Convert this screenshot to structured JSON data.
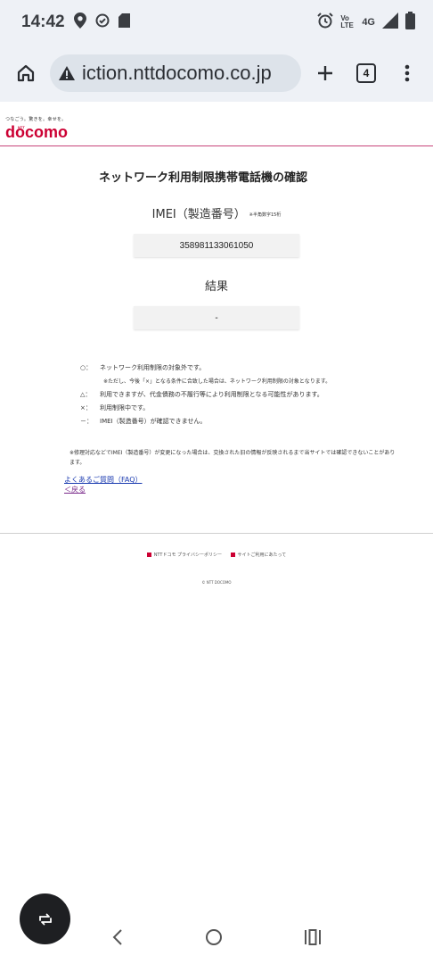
{
  "status_bar": {
    "time": "14:42",
    "network": "4G",
    "volte": "Vo LTE"
  },
  "browser": {
    "url": "iction.nttdocomo.co.jp",
    "tab_count": "4"
  },
  "brand": {
    "tagline": "つなごう。驚きを。幸せを。",
    "ntt": "NTT",
    "logo": "docomo"
  },
  "page": {
    "title": "ネットワーク利用制限携帯電話機の確認",
    "imei_label": "IMEI（製造番号）",
    "imei_note": "※半角数字15桁",
    "imei_value": "358981133061050",
    "result_label": "結果",
    "result_value": "-",
    "legend": [
      {
        "symbol": "○：",
        "text": "ネットワーク利用制限の対象外です。"
      },
      {
        "symbol": "",
        "text": "※ただし、今後「×」となる条件に合致した場合は、ネットワーク利用制限の対象となります。"
      },
      {
        "symbol": "△：",
        "text": "利用できますが、代金債務の不履行等により利用制限となる可能性があります。"
      },
      {
        "symbol": "×：",
        "text": "利用制限中です。"
      },
      {
        "symbol": "－：",
        "text": "IMEI（製造番号）が確認できません。"
      }
    ],
    "footnote": "※修理対応などでIMEI（製造番号）が変更になった場合は、交換された旧の情報が反映されるまで当サイトでは確認できないことがあります。",
    "faq_link": "よくあるご質問（FAQ）",
    "back_link": "＜戻る"
  },
  "footer": {
    "privacy": "NTTドコモ プライバシーポリシー",
    "terms": "サイトご利用にあたって",
    "copyright": "© NTT DOCOMO"
  }
}
